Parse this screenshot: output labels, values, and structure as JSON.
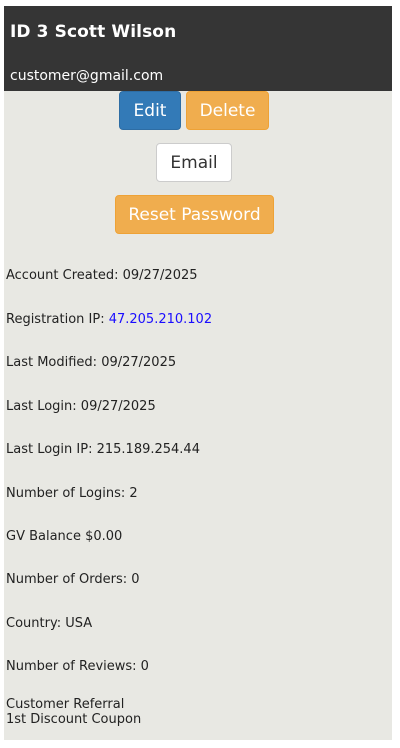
{
  "customer": {
    "title": "ID 3 Scott Wilson",
    "email": "customer@gmail.com"
  },
  "actions": {
    "edit_label": "Edit",
    "delete_label": "Delete",
    "email_label": "Email",
    "reset_label": "Reset Password"
  },
  "details": {
    "account_created": "Account Created: 09/27/2025",
    "registration_ip_label": "Registration IP: ",
    "registration_ip_value": "47.205.210.102",
    "last_modified": "Last Modified: 09/27/2025",
    "last_login": "Last Login: 09/27/2025",
    "last_login_ip": "Last Login IP: 215.189.254.44",
    "number_of_logins": "Number of Logins: 2",
    "gv_balance": "GV Balance $0.00",
    "number_of_orders": "Number of Orders: 0",
    "country": "Country: USA",
    "number_of_reviews": "Number of Reviews: 0",
    "referral_line1": "Customer Referral",
    "referral_line2": "1st Discount Coupon"
  },
  "colors": {
    "header_bg": "#353535",
    "panel_bg": "#e8e8e3",
    "primary": "#337ab7",
    "warning": "#f0ad4e",
    "link": "#1a0dff"
  }
}
